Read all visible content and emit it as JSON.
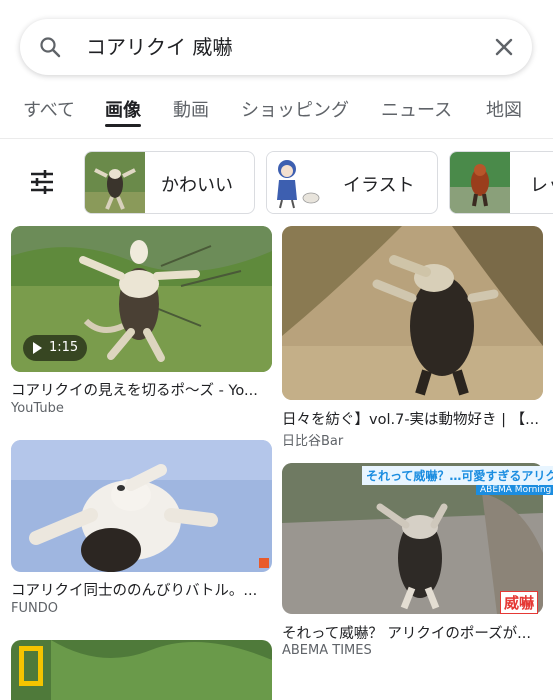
{
  "search": {
    "query": "コアリクイ 威嚇"
  },
  "tabs": [
    "すべて",
    "画像",
    "動画",
    "ショッピング",
    "ニュース",
    "地図"
  ],
  "chips": [
    "かわいい",
    "イラスト",
    "レッ"
  ],
  "results": [
    {
      "title": "コアリクイの見えを切るポ〜ズ - Yo...",
      "source": "YouTube",
      "duration": "1:15"
    },
    {
      "title": "日々を紡ぐ】vol.7-実は動物好き | 【...",
      "source": "日比谷Bar"
    },
    {
      "title": "コアリクイ同士ののんびりバトル。...",
      "source": "FUNDO"
    },
    {
      "title": "それって威嚇？ アリクイのポーズが...",
      "source": "ABEMA TIMES",
      "overlay_title": "それって威嚇？…可愛すぎるアリクイ",
      "overlay_tag": "ABEMA Morning",
      "overlay_stamp": "威嚇"
    }
  ],
  "colors": {
    "accent": "#1b8de0",
    "text": "#202124",
    "muted": "#5f6368"
  }
}
